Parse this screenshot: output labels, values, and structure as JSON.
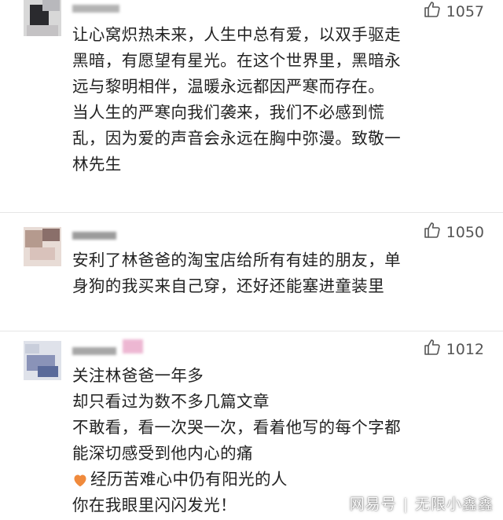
{
  "comments": [
    {
      "likes": "1057",
      "lines": [
        "让心窝炽热未来，人生中总有爱，以双手驱走",
        "黑暗，有愿望有星光。在这个世界里，黑暗永",
        "远与黎明相伴，温暖永远都因严寒而存在。",
        "当人生的严寒向我们袭来，我们不必感到慌",
        "乱，因为爱的声音会永远在胸中弥漫。致敬一",
        "林先生"
      ]
    },
    {
      "likes": "1050",
      "lines": [
        "安利了林爸爸的淘宝店给所有有娃的朋友，单",
        "身狗的我买来自己穿，还好还能塞进童装里"
      ]
    },
    {
      "likes": "1012",
      "lines": [
        "关注林爸爸一年多",
        "却只看过为数不多几篇文章",
        "不敢看，看一次哭一次，看着他写的每个字都",
        "能深切感受到他内心的痛",
        "经历苦难心中仍有阳光的人",
        "你在我眼里闪闪发光！"
      ]
    }
  ],
  "icons": {
    "like": "thumbs-up-icon",
    "heart": "orange-heart-icon"
  },
  "colors": {
    "heart": "#f08a3c",
    "text": "#222222",
    "like": "#555555"
  },
  "watermark": {
    "source": "网易号",
    "separator": "|",
    "author": "无限小鑫鑫"
  }
}
